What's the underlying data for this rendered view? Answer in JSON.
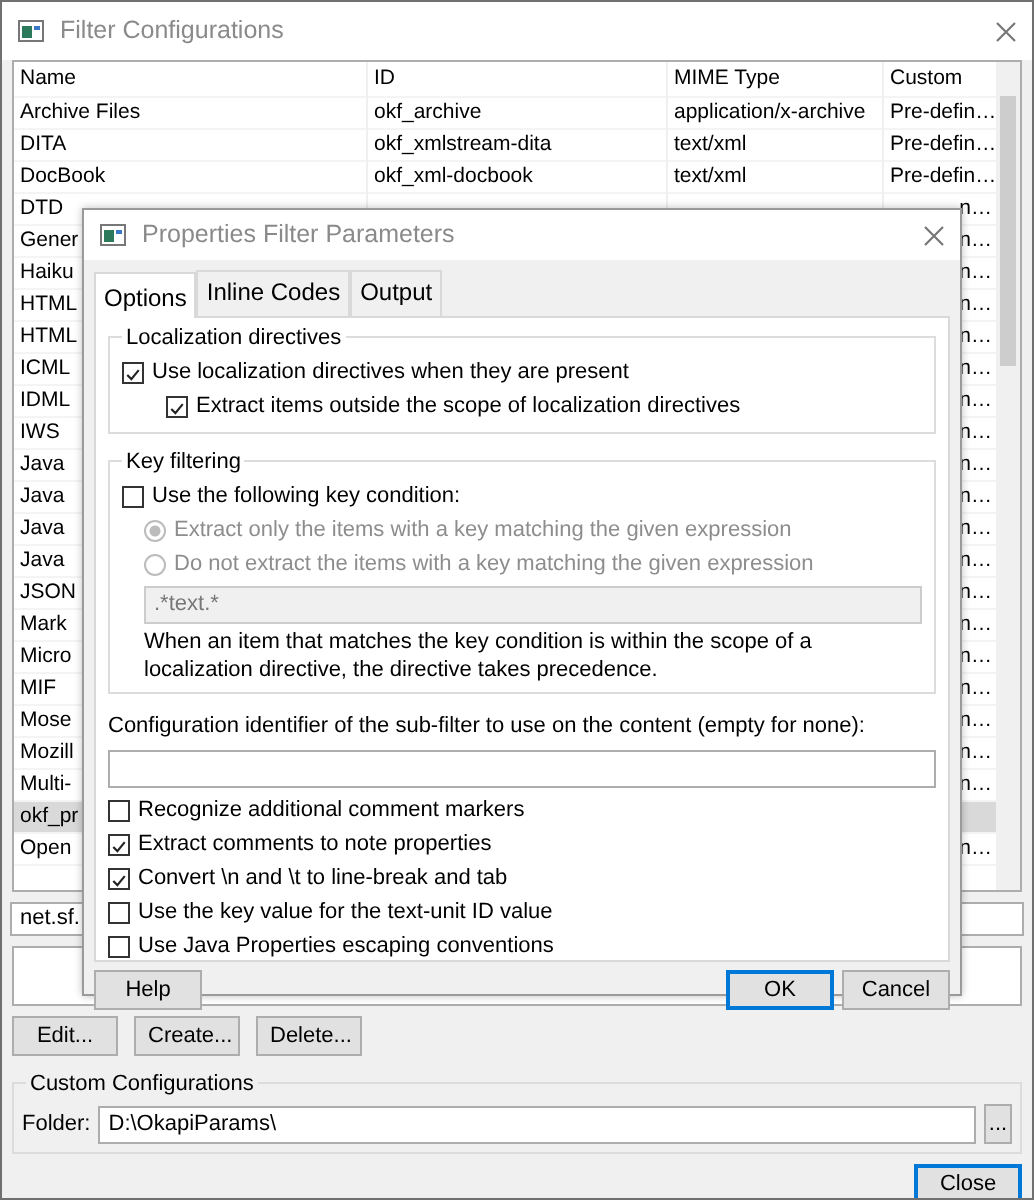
{
  "window": {
    "title": "Filter Configurations"
  },
  "table": {
    "columns": [
      "Name",
      "ID",
      "MIME Type",
      "Custom"
    ],
    "rows": [
      {
        "kind": "full",
        "selected": false,
        "cells": [
          "Archive Files",
          "okf_archive",
          "application/x-archive",
          "Pre-defin…"
        ]
      },
      {
        "kind": "full",
        "selected": false,
        "cells": [
          "DITA",
          "okf_xmlstream-dita",
          "text/xml",
          "Pre-defin…"
        ]
      },
      {
        "kind": "full",
        "selected": false,
        "cells": [
          "DocBook",
          "okf_xml-docbook",
          "text/xml",
          "Pre-defin…"
        ]
      },
      {
        "kind": "partial",
        "selected": false,
        "cells": [
          "DTD",
          "n…"
        ]
      },
      {
        "kind": "partial",
        "selected": false,
        "cells": [
          "Gener",
          "n…"
        ]
      },
      {
        "kind": "partial",
        "selected": false,
        "cells": [
          "Haiku",
          "n…"
        ]
      },
      {
        "kind": "partial",
        "selected": false,
        "cells": [
          "HTML",
          "n…"
        ]
      },
      {
        "kind": "partial",
        "selected": false,
        "cells": [
          "HTML",
          "n…"
        ]
      },
      {
        "kind": "partial",
        "selected": false,
        "cells": [
          "ICML",
          "n…"
        ]
      },
      {
        "kind": "partial",
        "selected": false,
        "cells": [
          "IDML",
          "n…"
        ]
      },
      {
        "kind": "partial",
        "selected": false,
        "cells": [
          "IWS",
          "n…"
        ]
      },
      {
        "kind": "partial",
        "selected": false,
        "cells": [
          "Java",
          "n…"
        ]
      },
      {
        "kind": "partial",
        "selected": false,
        "cells": [
          "Java",
          "n…"
        ]
      },
      {
        "kind": "partial",
        "selected": false,
        "cells": [
          "Java",
          "n…"
        ]
      },
      {
        "kind": "partial",
        "selected": false,
        "cells": [
          "Java",
          "n…"
        ]
      },
      {
        "kind": "partial",
        "selected": false,
        "cells": [
          "JSON",
          "n…"
        ]
      },
      {
        "kind": "partial",
        "selected": false,
        "cells": [
          "Mark",
          "n…"
        ]
      },
      {
        "kind": "partial",
        "selected": false,
        "cells": [
          "Micro",
          "n…"
        ]
      },
      {
        "kind": "partial",
        "selected": false,
        "cells": [
          "MIF",
          "n…"
        ]
      },
      {
        "kind": "partial",
        "selected": false,
        "cells": [
          "Mose",
          "n…"
        ]
      },
      {
        "kind": "partial",
        "selected": false,
        "cells": [
          "Mozill",
          "n…"
        ]
      },
      {
        "kind": "partial",
        "selected": false,
        "cells": [
          "Multi-",
          "n…"
        ]
      },
      {
        "kind": "partial",
        "selected": true,
        "cells": [
          "okf_pr",
          ""
        ]
      },
      {
        "kind": "partial",
        "selected": false,
        "cells": [
          "Open",
          "n…"
        ]
      }
    ]
  },
  "class_field": {
    "value": "net.sf."
  },
  "buttons": [
    "Edit...",
    "Create...",
    "Delete..."
  ],
  "custom_configurations": {
    "title": "Custom Configurations",
    "folder_label": "Folder:",
    "folder_value": "D:\\OkapiParams\\",
    "browse_button": "..."
  },
  "close_button": "Close",
  "dialog": {
    "title": "Properties Filter Parameters",
    "tabs": [
      {
        "label": "Options",
        "selected": true
      },
      {
        "label": "Inline Codes",
        "selected": false
      },
      {
        "label": "Output",
        "selected": false
      }
    ],
    "localization_group": {
      "title": "Localization directives",
      "options": [
        {
          "label": "Use localization directives when they are present",
          "checked": true,
          "children": [
            {
              "label": "Extract items outside the scope of localization directives",
              "checked": true
            }
          ]
        }
      ]
    },
    "key_group": {
      "title": "Key filtering",
      "use_condition": {
        "label": "Use the following key condition:",
        "checked": false
      },
      "radios": [
        {
          "label": "Extract only the items with a key matching the given expression",
          "selected": true,
          "disabled": true
        },
        {
          "label": "Do not extract the items with a key matching the given expression",
          "selected": false,
          "disabled": true
        }
      ],
      "expression": {
        "value": ".*text.*",
        "disabled": true
      },
      "note": "When an item that matches the key condition is within the scope of a localization directive, the directive takes precedence."
    },
    "subfilter": {
      "label": "Configuration identifier of the sub-filter to use on the content (empty for none):"
    },
    "options": [
      {
        "label": "Recognize additional comment markers",
        "checked": false
      },
      {
        "label": "Extract comments to note properties",
        "checked": true
      },
      {
        "label": "Convert \\n and \\t to line-break and tab",
        "checked": true
      },
      {
        "label": "Use the key value for the text-unit ID value",
        "checked": false
      },
      {
        "label": "Use Java Properties escaping conventions",
        "checked": false
      }
    ],
    "buttons": [
      {
        "label": "Help",
        "default": false
      },
      {
        "label": "OK",
        "default": true
      },
      {
        "label": "Cancel",
        "default": false
      }
    ]
  }
}
